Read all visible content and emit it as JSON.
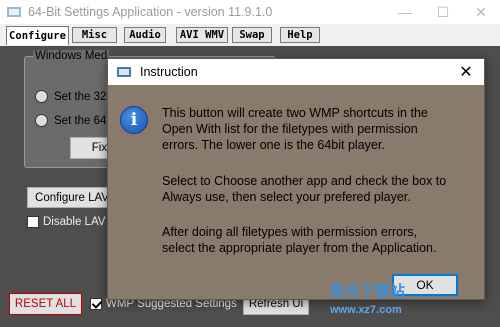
{
  "app": {
    "title": "64-Bit Settings Application - version 11.9.1.0",
    "icons": {
      "app": "app-logo-icon",
      "minimize": "minimize-icon",
      "maximize": "maximize-icon",
      "close": "close-icon"
    }
  },
  "tabs": [
    {
      "label": "Configure"
    },
    {
      "label": "Misc"
    },
    {
      "label": "Audio"
    },
    {
      "label": "AVI WMV"
    },
    {
      "label": "Swap"
    },
    {
      "label": "Help"
    }
  ],
  "main": {
    "group_title": "Windows Med",
    "radio1": "Set the 32-",
    "radio2": "Set the 64-",
    "fix_button": "Fix Per",
    "configure_lav_button": "Configure LAV",
    "disable_lav_checkbox": "Disable LAV t"
  },
  "bottom": {
    "reset_all": "RESET ALL",
    "wmp_checkbox": "WMP Suggested Settings",
    "refresh_button": "Refresh Ui"
  },
  "dialog": {
    "title": "Instruction",
    "para1": "This button will create two WMP shortcuts in the\nOpen With list for the filetypes with permission\nerrors. The lower one is the 64bit player.",
    "para2": "Select to Choose another app and check the box to\nAlways use, then select your prefered player.",
    "para3": "After doing all filetypes with permission errors,\nselect the appropriate player from the Application.",
    "ok_label": "OK"
  },
  "watermark": {
    "line1": "极光下载站",
    "line2": "www.xz7.com"
  }
}
